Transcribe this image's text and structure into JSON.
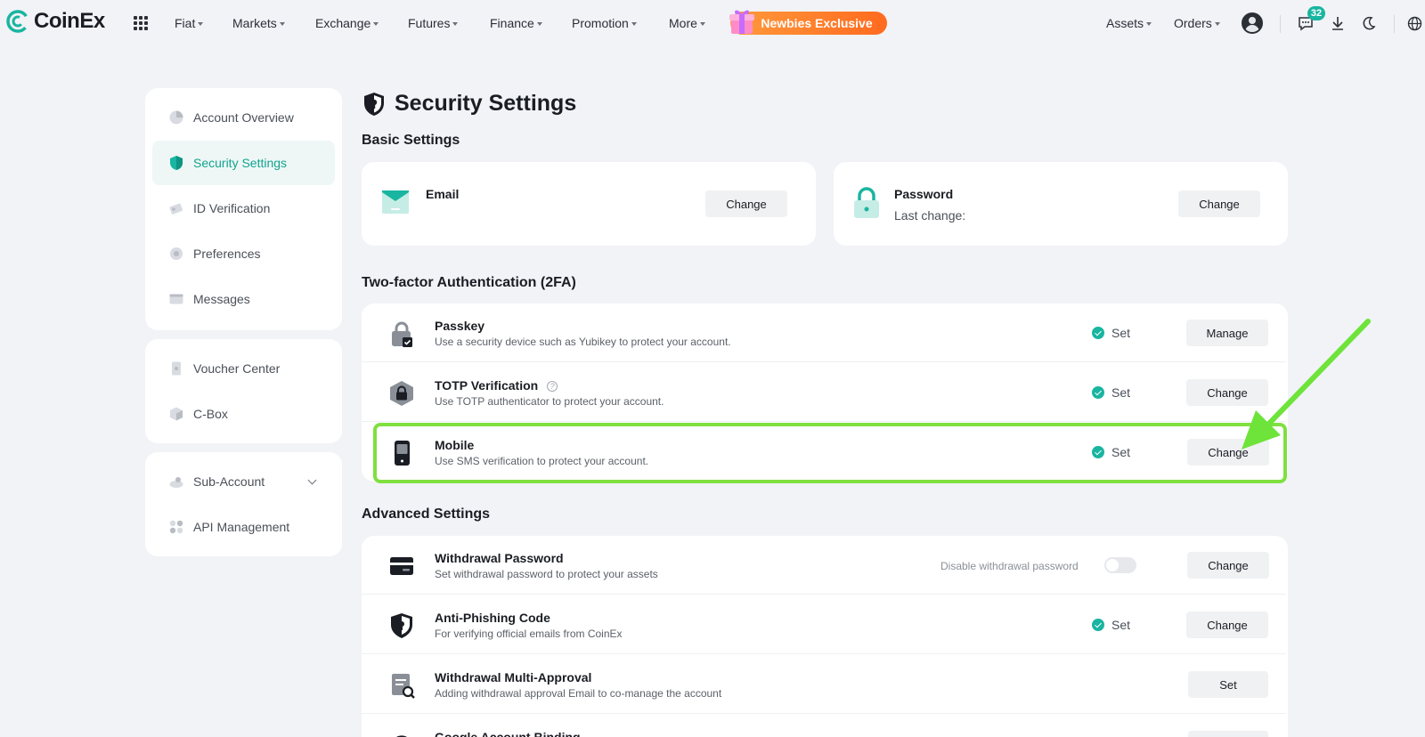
{
  "brand": {
    "name": "CoinEx",
    "accent": "#19b5a0"
  },
  "topnav": {
    "items": [
      "Fiat",
      "Markets",
      "Exchange",
      "Futures",
      "Finance",
      "Promotion",
      "More"
    ],
    "promo": "Newbies Exclusive",
    "right": {
      "assets": "Assets",
      "orders": "Orders",
      "notifications": "32"
    }
  },
  "sidebar": {
    "group1": [
      "Account Overview",
      "Security Settings",
      "ID Verification",
      "Preferences",
      "Messages"
    ],
    "group2": [
      "Voucher Center",
      "C-Box"
    ],
    "group3": [
      "Sub-Account",
      "API Management"
    ]
  },
  "page": {
    "title": "Security Settings"
  },
  "basic": {
    "title": "Basic Settings",
    "email": {
      "label": "Email",
      "button": "Change"
    },
    "password": {
      "label": "Password",
      "last_change": "Last change:",
      "button": "Change"
    }
  },
  "twofa": {
    "title": "Two-factor Authentication (2FA)",
    "rows": [
      {
        "title": "Passkey",
        "desc": "Use a security device such as Yubikey to protect your account.",
        "status": "Set",
        "button": "Manage"
      },
      {
        "title": "TOTP Verification",
        "desc": "Use TOTP authenticator to protect your account.",
        "status": "Set",
        "button": "Change"
      },
      {
        "title": "Mobile",
        "desc": "Use SMS verification to protect your account.",
        "status": "Set",
        "button": "Change"
      }
    ]
  },
  "advanced": {
    "title": "Advanced Settings",
    "rows": [
      {
        "title": "Withdrawal Password",
        "desc": "Set withdrawal password to protect your assets",
        "toggle_label": "Disable withdrawal password",
        "button": "Change"
      },
      {
        "title": "Anti-Phishing Code",
        "desc": "For verifying official emails from CoinEx",
        "status": "Set",
        "button": "Change"
      },
      {
        "title": "Withdrawal Multi-Approval",
        "desc": "Adding withdrawal approval Email to co-manage the account",
        "button": "Set"
      },
      {
        "title": "Google Account Binding",
        "desc": "",
        "button": ""
      }
    ]
  }
}
